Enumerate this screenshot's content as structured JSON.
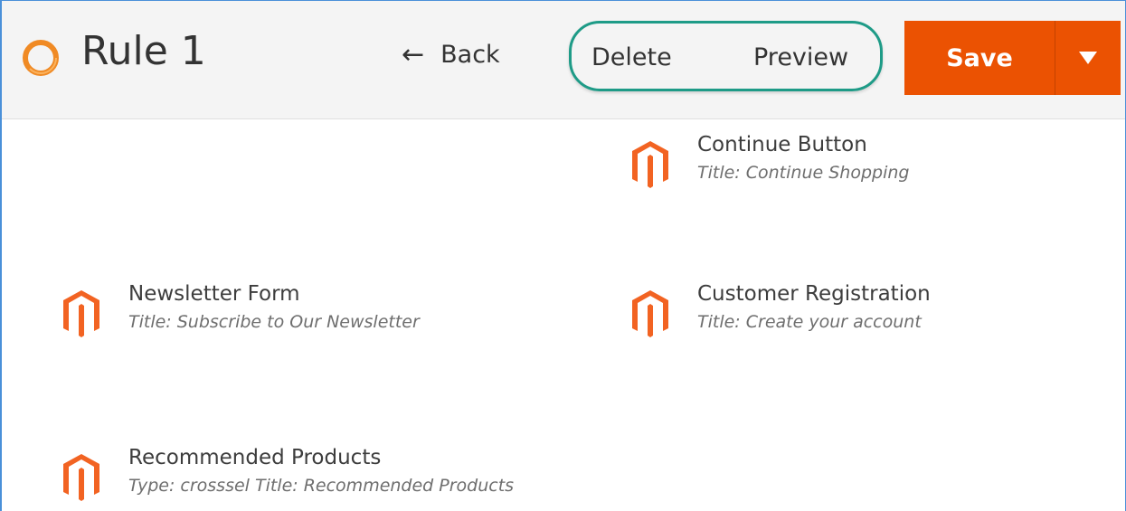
{
  "header": {
    "title": "Rule 1",
    "back_label": "Back",
    "delete_label": "Delete",
    "preview_label": "Preview",
    "save_label": "Save"
  },
  "colors": {
    "accent": "#eb5202",
    "highlight": "#1e9b87"
  },
  "widgets": [
    {
      "name": "Continue Button",
      "description": "Title: Continue Shopping"
    },
    {
      "name": "Newsletter Form",
      "description": "Title: Subscribe to Our Newsletter"
    },
    {
      "name": "Customer Registration",
      "description": "Title: Create your account"
    },
    {
      "name": "Recommended Products",
      "description": "Type: crosssel Title: Recommended Products"
    }
  ]
}
